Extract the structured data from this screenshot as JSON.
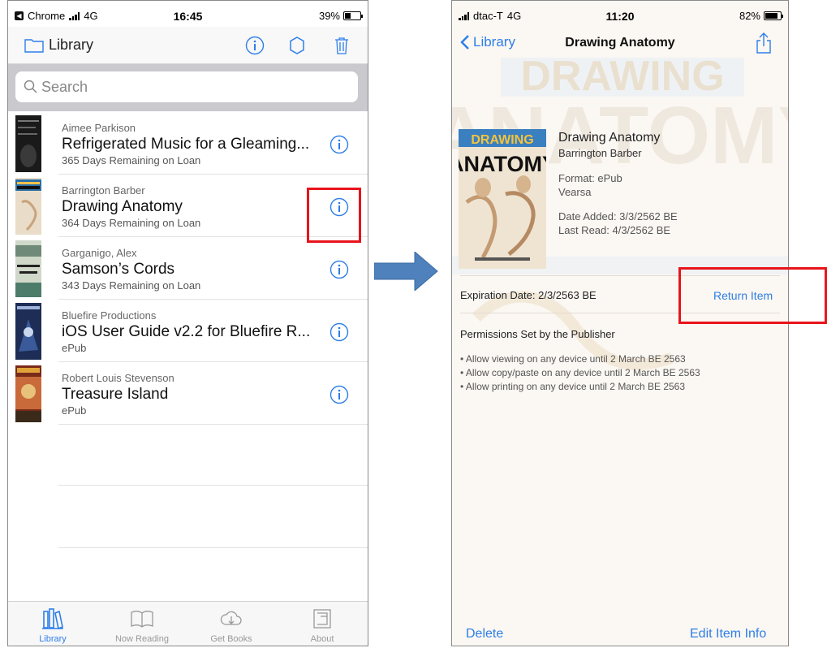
{
  "left": {
    "status": {
      "carrier": "Chrome",
      "network": "4G",
      "time": "16:45",
      "battery": "39%"
    },
    "nav": {
      "title": "Library"
    },
    "search": {
      "placeholder": "Search"
    },
    "books": [
      {
        "author": "Aimee Parkison",
        "title": "Refrigerated Music for a Gleaming...",
        "detail": "365 Days Remaining on Loan"
      },
      {
        "author": "Barrington Barber",
        "title": "Drawing Anatomy",
        "detail": "364 Days Remaining on Loan"
      },
      {
        "author": "Garganigo, Alex",
        "title": "Samson’s Cords",
        "detail": "343 Days Remaining on Loan"
      },
      {
        "author": "Bluefire Productions",
        "title": "iOS User Guide v2.2 for Bluefire R...",
        "detail": "ePub"
      },
      {
        "author": "Robert Louis Stevenson",
        "title": "Treasure Island",
        "detail": "ePub"
      }
    ],
    "tabs": [
      {
        "label": "Library",
        "icon": "library-icon"
      },
      {
        "label": "Now Reading",
        "icon": "open-book-icon"
      },
      {
        "label": "Get Books",
        "icon": "download-cloud-icon"
      },
      {
        "label": "About",
        "icon": "about-icon"
      }
    ]
  },
  "right": {
    "status": {
      "carrier": "dtac-T",
      "network": "4G",
      "time": "11:20",
      "battery": "82%"
    },
    "nav": {
      "back": "Library",
      "title": "Drawing Anatomy"
    },
    "book": {
      "title": "Drawing Anatomy",
      "author": "Barrington Barber",
      "format": "Format: ePub",
      "source": "Vearsa",
      "added": "Date Added: 3/3/2562 BE",
      "last_read": "Last Read: 4/3/2562 BE"
    },
    "expiration": "Expiration Date: 2/3/2563 BE",
    "return_label": "Return Item",
    "permissions_heading": "Permissions Set by the Publisher",
    "permissions": [
      "• Allow viewing on any device until 2 March BE 2563",
      "• Allow copy/paste on any device until 2 March BE 2563",
      "• Allow printing on any device until 2 March BE 2563"
    ],
    "delete_label": "Delete",
    "edit_label": "Edit Item Info"
  },
  "colors": {
    "accent": "#2d7ee9",
    "highlight": "#e8141b",
    "arrow": "#4f81bd"
  }
}
